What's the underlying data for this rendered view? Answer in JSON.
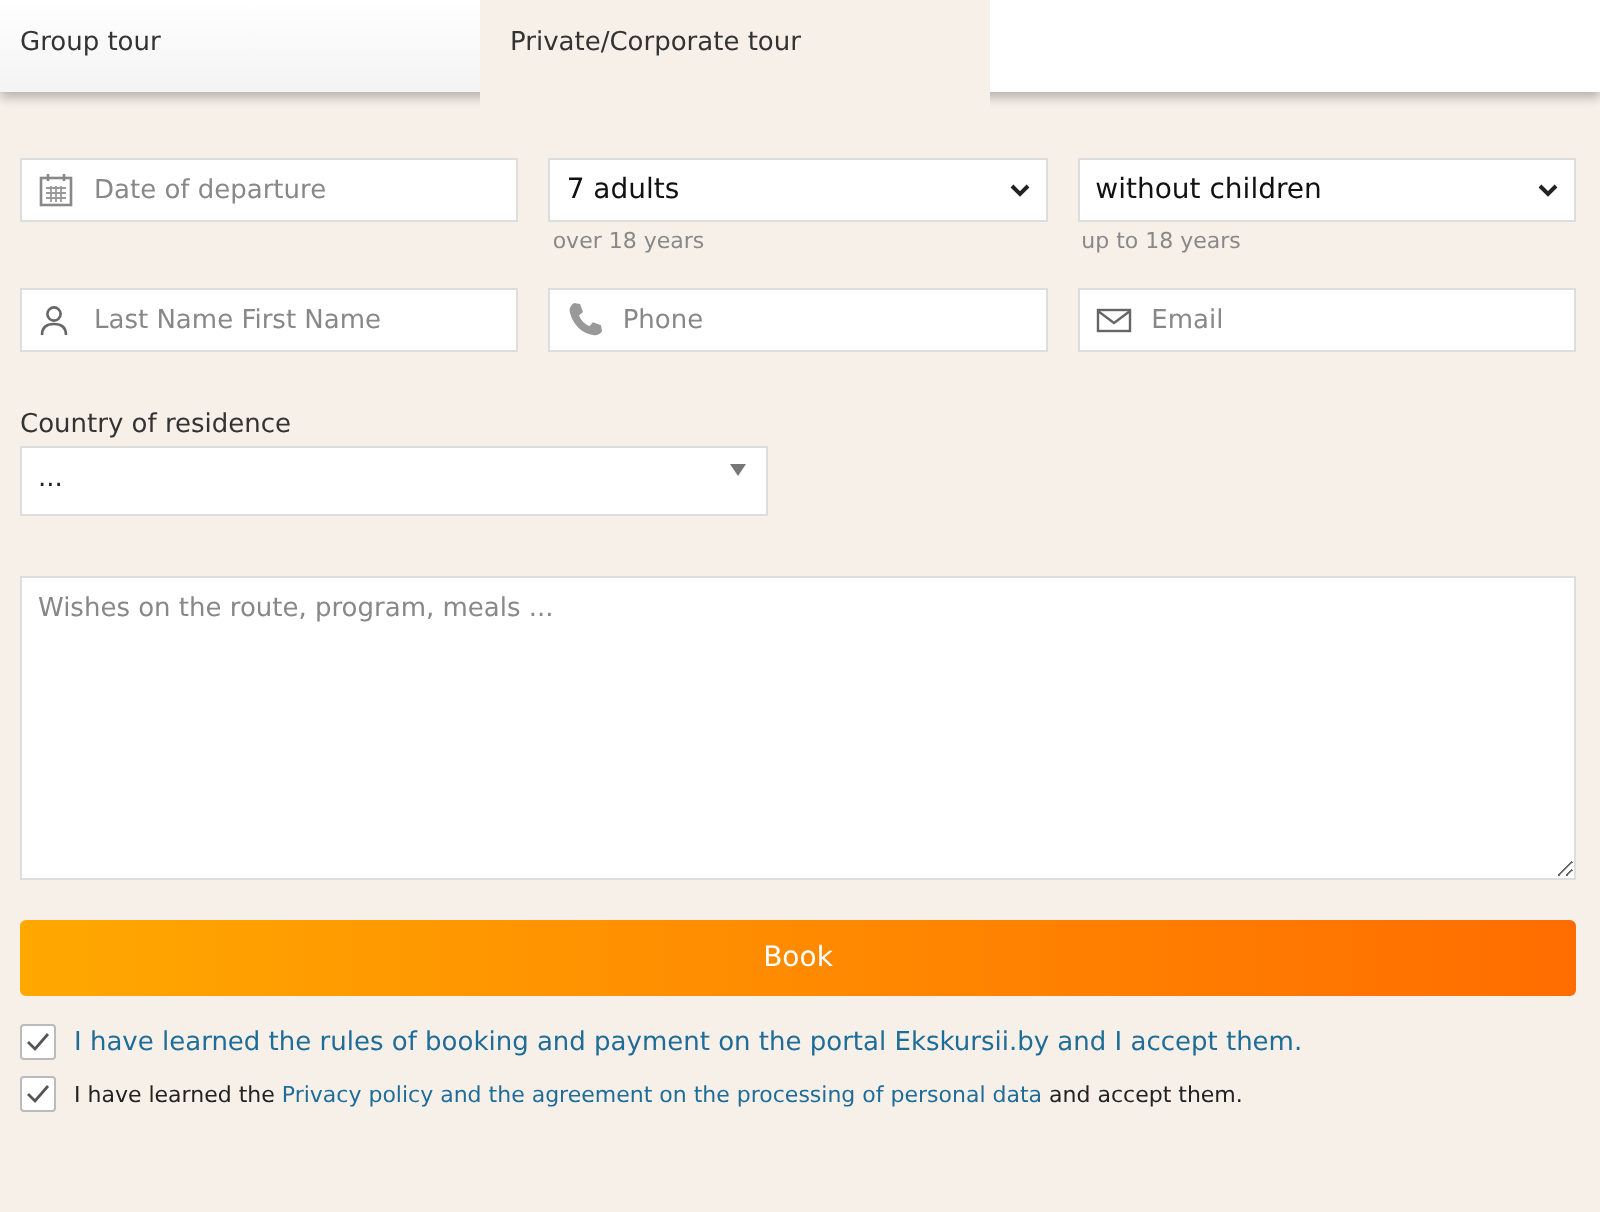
{
  "tabs": [
    {
      "label": "Group tour",
      "selected": false
    },
    {
      "label": "Private/Corporate tour",
      "selected": true
    }
  ],
  "departure": {
    "placeholder": "Date of departure"
  },
  "adults": {
    "value": "7 adults",
    "hint": "over 18 years"
  },
  "children": {
    "value": "without children",
    "hint": "up to 18 years"
  },
  "name": {
    "placeholder": "Last Name First Name"
  },
  "phone": {
    "placeholder": "Phone"
  },
  "email": {
    "placeholder": "Email"
  },
  "country": {
    "label": "Country of residence",
    "value": "..."
  },
  "wishes": {
    "placeholder": "Wishes on the route, program, meals ..."
  },
  "book_button": "Book",
  "agreements": [
    {
      "checked": true,
      "kind": "link",
      "text": "I have learned the rules of booking and payment on the portal Ekskursii.by and I accept them."
    },
    {
      "checked": true,
      "kind": "mixed",
      "before": "I have learned the ",
      "link": "Privacy policy and the agreement on the processing of personal data",
      "after": " and accept them."
    }
  ]
}
